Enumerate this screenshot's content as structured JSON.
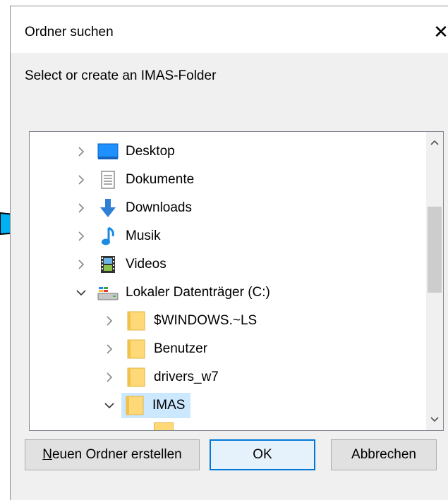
{
  "dialog": {
    "title": "Ordner suchen",
    "close_glyph": "✕",
    "instruction": "Select or create an IMAS-Folder"
  },
  "tree": {
    "items": [
      {
        "label": "Desktop",
        "icon": "desktop-icon",
        "expanded": false,
        "level": 1
      },
      {
        "label": "Dokumente",
        "icon": "documents-icon",
        "expanded": false,
        "level": 1
      },
      {
        "label": "Downloads",
        "icon": "downloads-icon",
        "expanded": false,
        "level": 1
      },
      {
        "label": "Musik",
        "icon": "music-icon",
        "expanded": false,
        "level": 1
      },
      {
        "label": "Videos",
        "icon": "videos-icon",
        "expanded": false,
        "level": 1
      },
      {
        "label": "Lokaler Datenträger (C:)",
        "icon": "drive-icon",
        "expanded": true,
        "level": 1
      },
      {
        "label": "$WINDOWS.~LS",
        "icon": "folder-icon",
        "expanded": false,
        "level": 2
      },
      {
        "label": "Benutzer",
        "icon": "folder-icon",
        "expanded": false,
        "level": 2
      },
      {
        "label": "drivers_w7",
        "icon": "folder-icon",
        "expanded": false,
        "level": 2
      },
      {
        "label": "IMAS",
        "icon": "folder-icon",
        "expanded": true,
        "level": 2,
        "selected": true
      }
    ]
  },
  "buttons": {
    "new_folder_accel": "N",
    "new_folder_rest": "euen Ordner erstellen",
    "ok": "OK",
    "cancel": "Abbrechen"
  },
  "colors": {
    "selection": "#cce8ff",
    "default_button_border": "#0078d7",
    "annotation_arrow": "#00b0f0"
  }
}
